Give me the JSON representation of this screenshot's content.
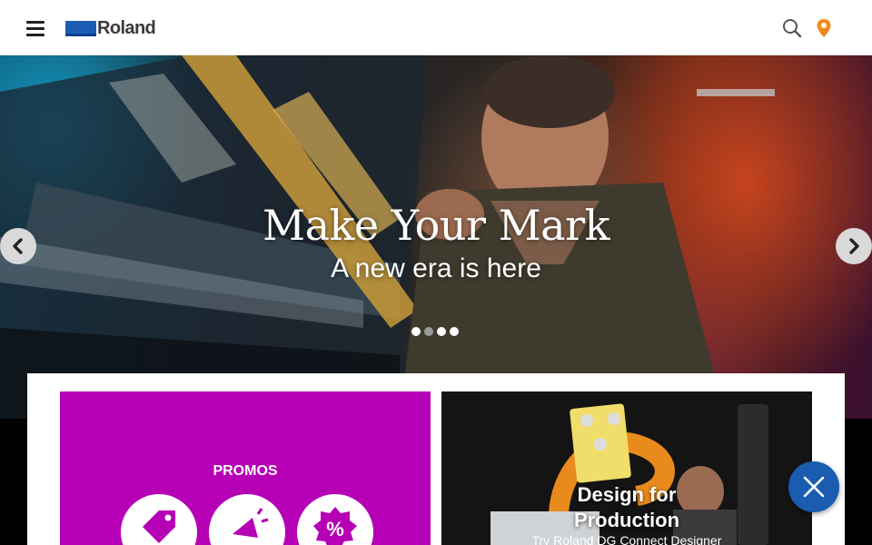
{
  "header": {
    "menu_icon": "hamburger-menu-icon",
    "logo_text": "Roland",
    "search_icon": "search-icon",
    "location_icon": "location-pin-icon"
  },
  "hero": {
    "title": "Make Your Mark",
    "subtitle": "A new era is here",
    "prev_icon": "chevron-left-icon",
    "next_icon": "chevron-right-icon",
    "slides": 4,
    "active_slide": 1
  },
  "cards": {
    "promos": {
      "title": "PROMOS",
      "icons": [
        "price-tag-icon",
        "megaphone-icon",
        "percent-badge-icon"
      ]
    },
    "design": {
      "title_line1": "Design for",
      "title_line2": "Production",
      "subtitle": "Try Roland DG Connect Designer"
    }
  },
  "fab": {
    "icon": "close-icon"
  },
  "colors": {
    "brand_blue": "#1d5cb4",
    "promo_magenta": "#b600b6",
    "location_orange": "#f08a1c",
    "fab_blue": "#1a5cb0"
  }
}
